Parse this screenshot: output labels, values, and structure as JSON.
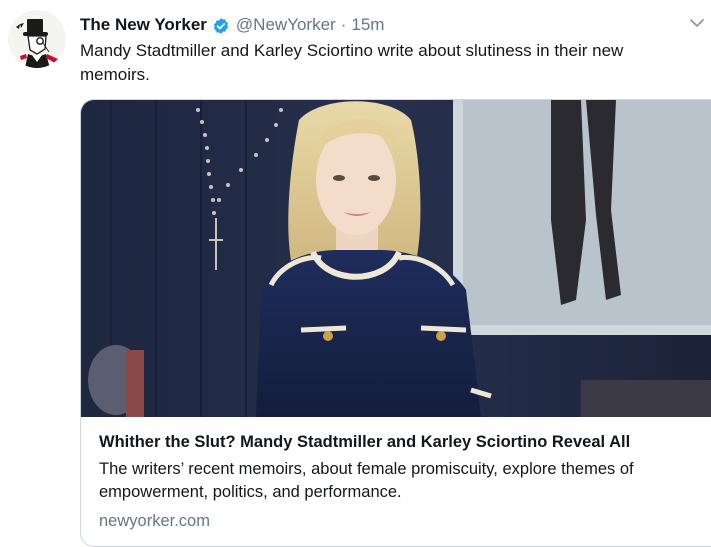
{
  "tweet": {
    "author": {
      "name": "The New Yorker",
      "handle": "@NewYorker",
      "verified": true,
      "avatar_icon": "eustace-tilley-monocle-avatar"
    },
    "separator": "·",
    "time": "15m",
    "text": "Mandy Stadtmiller and Karley Sciortino write about slutiness in their new memoirs."
  },
  "card": {
    "title": "Whither the Slut? Mandy Stadtmiller and Karley Sciortino Reveal All",
    "description": "The writers’ recent memoirs, about female promiscuity, explore themes of empowerment, politics, and performance.",
    "domain": "newyorker.com"
  },
  "colors": {
    "text": "#14171a",
    "muted": "#657786",
    "verified": "#1da1f2",
    "border": "#ccd6dd"
  }
}
